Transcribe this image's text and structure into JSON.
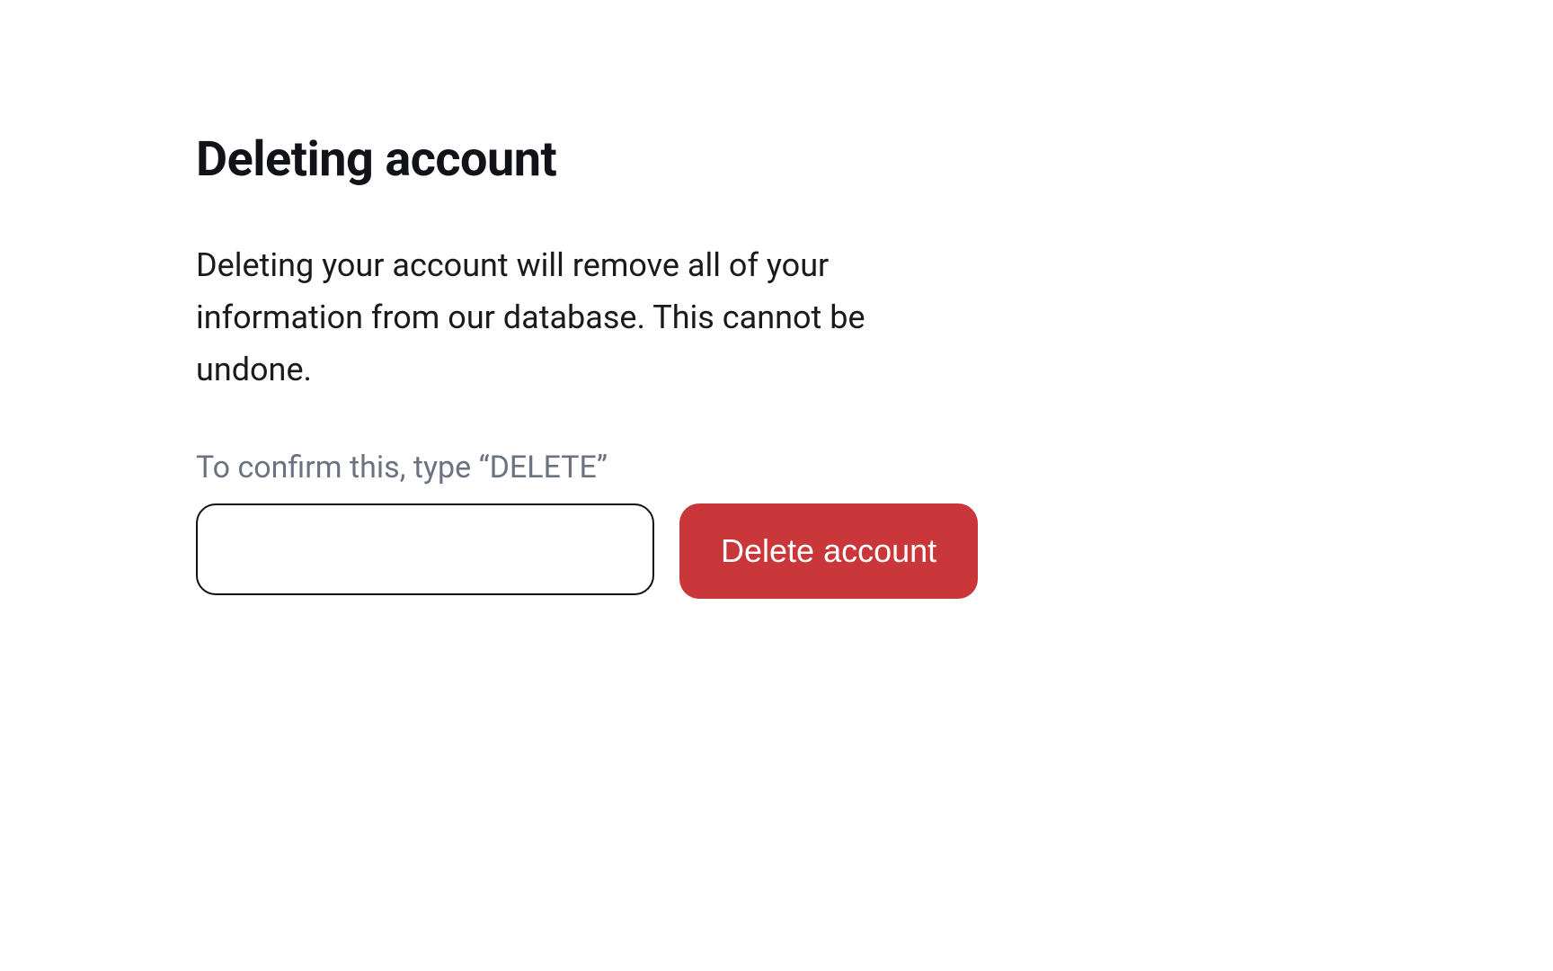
{
  "dialog": {
    "heading": "Deleting account",
    "description": "Deleting your account will remove all of your information from our database. This cannot be undone.",
    "confirm_label": "To confirm this, type “DELETE”",
    "input_value": "",
    "delete_button_label": "Delete account"
  },
  "colors": {
    "danger": "#c9373a"
  }
}
